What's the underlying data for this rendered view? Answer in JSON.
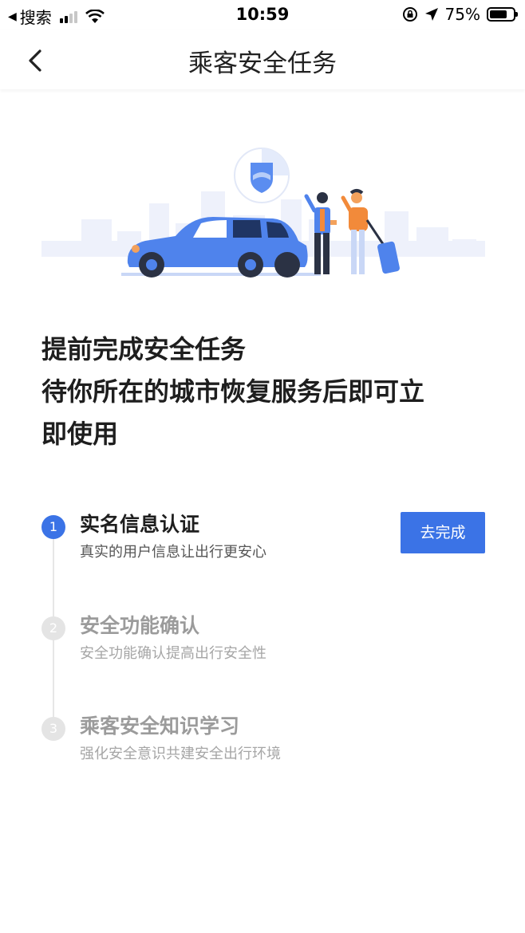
{
  "status_bar": {
    "back_app": "搜索",
    "time": "10:59",
    "battery": "75%",
    "battery_level": 0.75
  },
  "nav": {
    "title": "乘客安全任务"
  },
  "headline": {
    "line1": "提前完成安全任务",
    "line2": "待你所在的城市恢复服务后即可立",
    "line3": "即使用"
  },
  "steps": [
    {
      "number": "1",
      "title": "实名信息认证",
      "desc": "真实的用户信息让出行更安心",
      "button": "去完成",
      "active": true
    },
    {
      "number": "2",
      "title": "安全功能确认",
      "desc": "安全功能确认提高出行安全性",
      "active": false
    },
    {
      "number": "3",
      "title": "乘客安全知识学习",
      "desc": "强化安全意识共建安全出行环境",
      "active": false
    }
  ],
  "colors": {
    "accent": "#3b73e6",
    "inactive": "#e4e4e4"
  }
}
